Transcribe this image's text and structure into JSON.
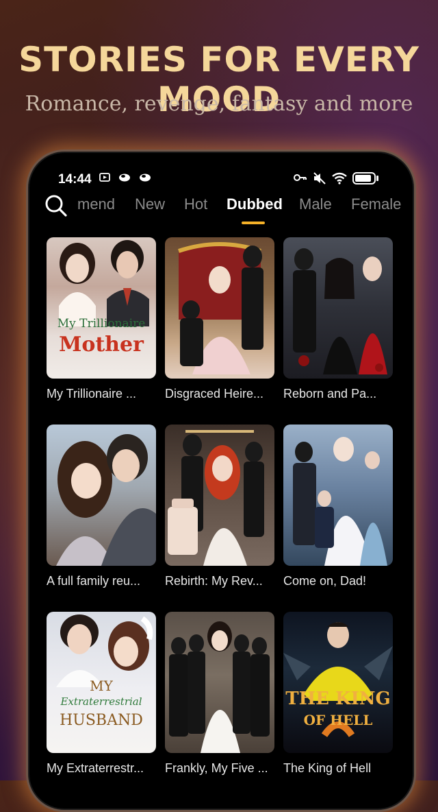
{
  "promo": {
    "headline": "Stories for every mood",
    "subline": "Romance, revenge, fantasy and more"
  },
  "status_bar": {
    "time": "14:44",
    "battery_level_percent": 90
  },
  "tabs": [
    {
      "label": "mend",
      "active": false
    },
    {
      "label": "New",
      "active": false
    },
    {
      "label": "Hot",
      "active": false
    },
    {
      "label": "Dubbed",
      "active": true
    },
    {
      "label": "Male",
      "active": false
    },
    {
      "label": "Female",
      "active": false
    }
  ],
  "colors": {
    "accent": "#f5b128",
    "headline": "#f5d79a",
    "phone_glow": "#e68c3c"
  },
  "dramas": [
    {
      "title": "My Trillionaire ...",
      "poster_text_1": "My Trillionaire",
      "poster_text_2": "Mother"
    },
    {
      "title": "Disgraced Heire..."
    },
    {
      "title": "Reborn and Pa..."
    },
    {
      "title": "A full family reu..."
    },
    {
      "title": "Rebirth: My Rev..."
    },
    {
      "title": "Come on, Dad!"
    },
    {
      "title": "My Extraterrestr...",
      "poster_text_1": "MY",
      "poster_text_2": "Extraterrestrial",
      "poster_text_3": "HUSBAND"
    },
    {
      "title": "Frankly, My Five ..."
    },
    {
      "title": "The King of Hell",
      "poster_text_1": "THE KING",
      "poster_text_2": "OF HELL"
    }
  ]
}
